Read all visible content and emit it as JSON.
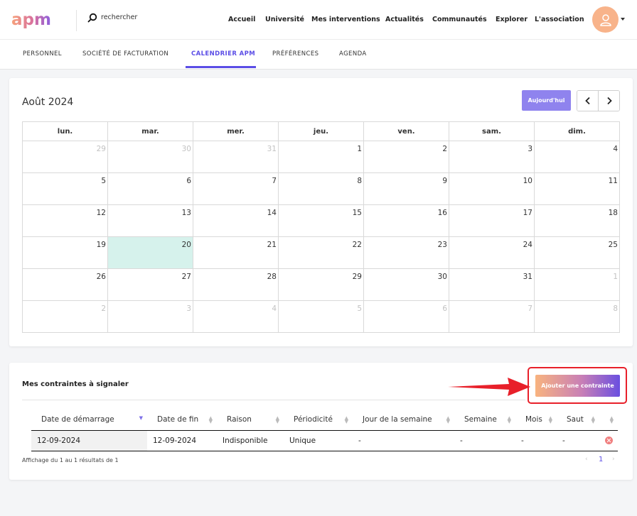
{
  "header": {
    "logo_text": "apm",
    "search": {
      "placeholder": "rechercher"
    },
    "nav": [
      {
        "label": "Accueil"
      },
      {
        "label": "Université"
      },
      {
        "label": "Mes interventions"
      },
      {
        "label": "Actualités"
      },
      {
        "label": "Communautés"
      },
      {
        "label": "Explorer"
      },
      {
        "label": "L'association"
      }
    ],
    "avatar_color": "#f8b38a"
  },
  "tabs": [
    {
      "label": "PERSONNEL"
    },
    {
      "label": "SOCIÉTÉ DE FACTURATION"
    },
    {
      "label": "CALENDRIER APM",
      "active": true
    },
    {
      "label": "PRÉFÉRENCES"
    },
    {
      "label": "AGENDA"
    }
  ],
  "calendar": {
    "title": "Août 2024",
    "today_label": "Aujourd'hui",
    "weekdays": [
      "lun.",
      "mar.",
      "mer.",
      "jeu.",
      "ven.",
      "sam.",
      "dim."
    ],
    "weeks": [
      [
        "29",
        "30",
        "31",
        "1",
        "2",
        "3",
        "4"
      ],
      [
        "5",
        "6",
        "7",
        "8",
        "9",
        "10",
        "11"
      ],
      [
        "12",
        "13",
        "14",
        "15",
        "16",
        "17",
        "18"
      ],
      [
        "19",
        "20",
        "21",
        "22",
        "23",
        "24",
        "25"
      ],
      [
        "26",
        "27",
        "28",
        "29",
        "30",
        "31",
        "1"
      ],
      [
        "2",
        "3",
        "4",
        "5",
        "6",
        "7",
        "8"
      ]
    ],
    "today": "20",
    "accent_color": "#5b4de6",
    "today_bg": "#d6f2ec"
  },
  "constraints": {
    "title": "Mes contraintes à signaler",
    "add_button_label": "Ajouter une contrainte",
    "columns": [
      "Date de démarrage",
      "Date de fin",
      "Raison",
      "Périodicité",
      "Jour de la semaine",
      "Semaine",
      "Mois",
      "Saut",
      ""
    ],
    "rows": [
      [
        "12-09-2024",
        "12-09-2024",
        "Indisponible",
        "Unique",
        "-",
        "-",
        "-",
        "-",
        ""
      ]
    ],
    "info": "Affichage du 1 au 1 résultats de 1",
    "pager": {
      "prev": "‹",
      "page": "1",
      "next": "›"
    },
    "highlight_color": "#e8202a"
  }
}
